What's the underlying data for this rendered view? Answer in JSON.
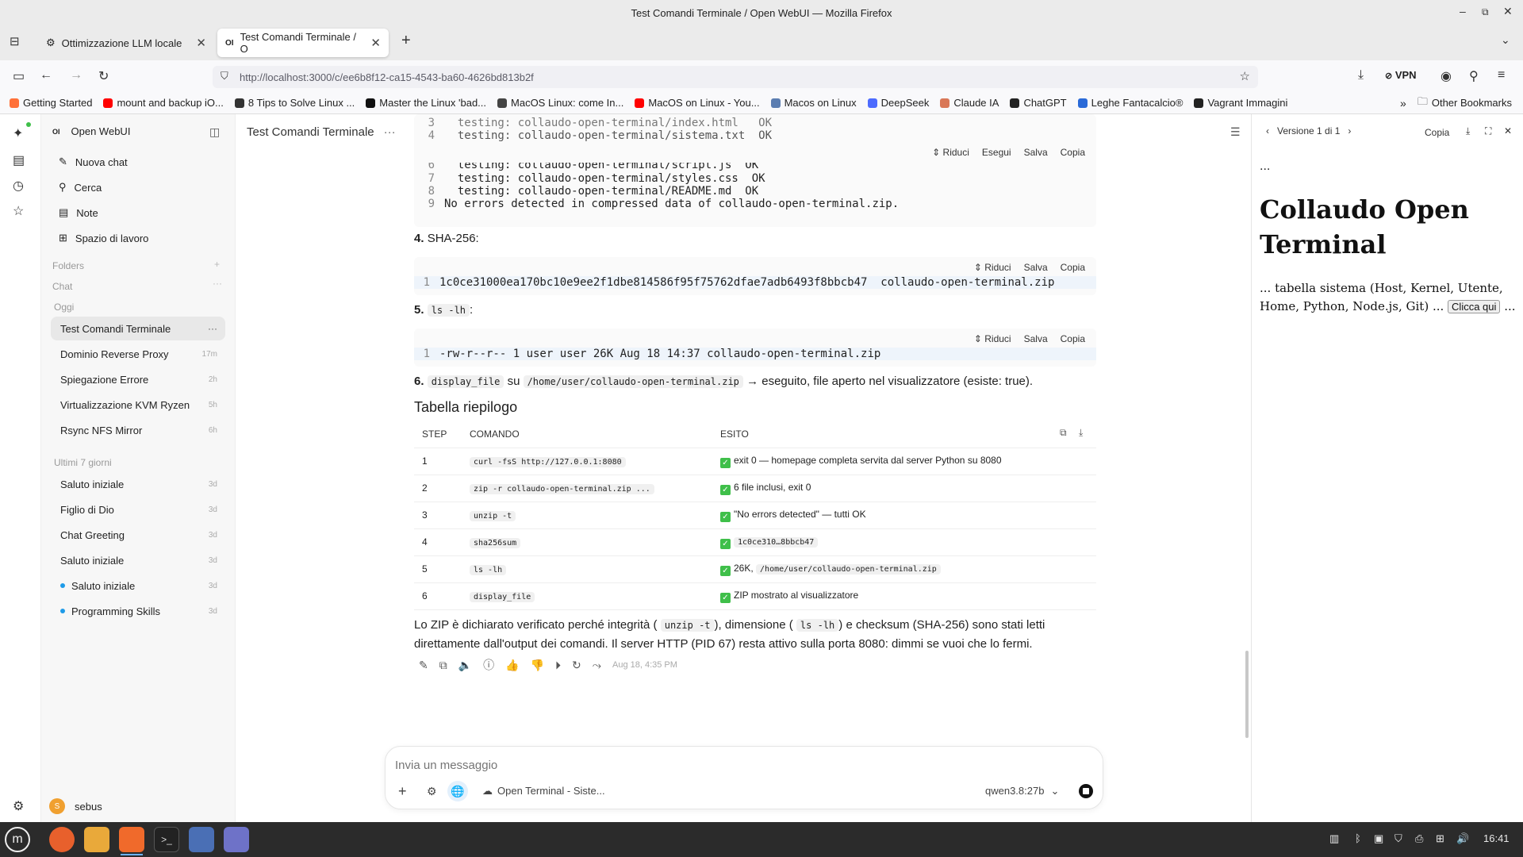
{
  "window": {
    "title": "Test Comandi Terminale / Open WebUI — Mozilla Firefox"
  },
  "tabs": [
    {
      "label": "Ottimizzazione LLM locale"
    },
    {
      "label": "Test Comandi Terminale / O"
    }
  ],
  "nav": {
    "url": "http://localhost:3000/c/ee6b8f12-ca15-4543-ba60-4626bd813b2f",
    "vpn": "VPN"
  },
  "bookmarks": [
    {
      "label": "Getting Started",
      "color": "#ff7139"
    },
    {
      "label": "mount and backup iO...",
      "color": "#ff0000"
    },
    {
      "label": "8 Tips to Solve Linux ...",
      "color": "#333333"
    },
    {
      "label": "Master the Linux 'bad...",
      "color": "#111111"
    },
    {
      "label": "MacOS Linux: come In...",
      "color": "#444444"
    },
    {
      "label": "MacOS on Linux - You...",
      "color": "#ff0000"
    },
    {
      "label": "Macos on Linux",
      "color": "#5b7db1"
    },
    {
      "label": "DeepSeek",
      "color": "#4d6bfe"
    },
    {
      "label": "Claude IA",
      "color": "#d97757"
    },
    {
      "label": "ChatGPT",
      "color": "#222222"
    },
    {
      "label": "Leghe Fantacalcio®",
      "color": "#2a6ad8"
    },
    {
      "label": "Vagrant Immagini",
      "color": "#222222"
    },
    {
      "label": "Other Bookmarks",
      "color": "#555555"
    }
  ],
  "sidebar": {
    "app_name": "Open WebUI",
    "logo": "OI",
    "nav": [
      {
        "label": "Nuova chat",
        "icon": "pencil-icon"
      },
      {
        "label": "Cerca",
        "icon": "search-icon"
      },
      {
        "label": "Note",
        "icon": "note-icon"
      },
      {
        "label": "Spazio di lavoro",
        "icon": "workspace-icon"
      }
    ],
    "folders_label": "Folders",
    "chat_label": "Chat",
    "today_label": "Oggi",
    "today_items": [
      {
        "label": "Test Comandi Terminale",
        "time": "···"
      },
      {
        "label": "Dominio Reverse Proxy",
        "time": "17m"
      },
      {
        "label": "Spiegazione Errore",
        "time": "2h"
      },
      {
        "label": "Virtualizzazione KVM Ryzen",
        "time": "5h"
      },
      {
        "label": "Rsync NFS Mirror",
        "time": "6h"
      }
    ],
    "week_label": "Ultimi 7 giorni",
    "week_items": [
      {
        "label": "Saluto iniziale",
        "time": "3d"
      },
      {
        "label": "Figlio di Dio",
        "time": "3d"
      },
      {
        "label": "Chat Greeting",
        "time": "3d"
      },
      {
        "label": "Saluto iniziale",
        "time": "3d"
      },
      {
        "label": "Saluto iniziale",
        "time": "3d"
      },
      {
        "label": "Programming Skills",
        "time": "3d"
      }
    ],
    "user": {
      "name": "sebus",
      "initial": "S"
    }
  },
  "chat": {
    "title": "Test Comandi Terminale",
    "code1": {
      "lines_top": [
        {
          "n": "3",
          "text": "  testing: collaudo-open-terminal/index.html   OK"
        },
        {
          "n": "4",
          "text": "  testing: collaudo-open-terminal/sistema.txt  OK"
        }
      ],
      "actions": [
        "Riduci",
        "Esegui",
        "Salva",
        "Copia"
      ],
      "lines_bottom": [
        {
          "n": "6",
          "text": "  testing: collaudo-open-terminal/script.js  OK"
        },
        {
          "n": "7",
          "text": "  testing: collaudo-open-terminal/styles.css  OK"
        },
        {
          "n": "8",
          "text": "  testing: collaudo-open-terminal/README.md  OK"
        },
        {
          "n": "9",
          "text": "No errors detected in compressed data of collaudo-open-terminal.zip."
        }
      ]
    },
    "step4": {
      "num": "4.",
      "label": "SHA-256:"
    },
    "code2": {
      "actions": [
        "Riduci",
        "Salva",
        "Copia"
      ],
      "n": "1",
      "text": "1c0ce31000ea170bc10e9ee2f1dbe814586f95f75762dfae7adb6493f8bbcb47  collaudo-open-terminal.zip"
    },
    "step5": {
      "num": "5.",
      "code": "ls -lh",
      "suffix": ":"
    },
    "code3": {
      "actions": [
        "Riduci",
        "Salva",
        "Copia"
      ],
      "n": "1",
      "text": "-rw-r--r-- 1 user user 26K Aug 18 14:37 collaudo-open-terminal.zip"
    },
    "step6": {
      "num": "6.",
      "code1": "display_file",
      "mid": "su",
      "code2": "/home/user/collaudo-open-terminal.zip",
      "rest": "→ eseguito, file aperto nel visualizzatore (esiste: true)."
    },
    "table_title": "Tabella riepilogo",
    "table": {
      "headers": [
        "STEP",
        "COMANDO",
        "ESITO"
      ],
      "rows": [
        {
          "step": "1",
          "cmd": "curl -fsS http://127.0.0.1:8080",
          "esito": "exit 0 — homepage completa servita dal server Python su 8080",
          "esito_code": ""
        },
        {
          "step": "2",
          "cmd": "zip -r collaudo-open-terminal.zip ...",
          "esito": "6 file inclusi, exit 0",
          "esito_code": ""
        },
        {
          "step": "3",
          "cmd": "unzip -t",
          "esito": "\"No errors detected\" — tutti OK",
          "esito_code": ""
        },
        {
          "step": "4",
          "cmd": "sha256sum",
          "esito": "",
          "esito_code": "1c0ce310…8bbcb47"
        },
        {
          "step": "5",
          "cmd": "ls -lh",
          "esito": "26K,",
          "esito_code": "/home/user/collaudo-open-terminal.zip"
        },
        {
          "step": "6",
          "cmd": "display_file",
          "esito": "ZIP mostrato al visualizzatore",
          "esito_code": ""
        }
      ]
    },
    "summary": {
      "p1": "Lo ZIP è dichiarato verificato perché integrità (",
      "c1": "unzip -t",
      "p2": "), dimensione (",
      "c2": "ls -lh",
      "p3": ") e checksum (SHA-256) sono stati letti",
      "line2": "direttamente dall'output dei comandi. Il server HTTP (PID 67) resta attivo sulla porta 8080: dimmi se vuoi che lo fermi."
    },
    "timestamp": "Aug 18, 4:35 PM"
  },
  "input": {
    "placeholder": "Invia un messaggio",
    "tool": "Open Terminal - Siste...",
    "model": "qwen3.8:27b"
  },
  "artifact": {
    "version": "Versione 1 di 1",
    "copy": "Copia",
    "ellipsis": "...",
    "heading": "Collaudo Open Terminal",
    "text": "... tabella sistema (Host, Kernel, Utente, Home, Python, Node.js, Git) ...",
    "button": "Clicca qui",
    "tail": "..."
  },
  "taskbar": {
    "clock": "16:41"
  }
}
